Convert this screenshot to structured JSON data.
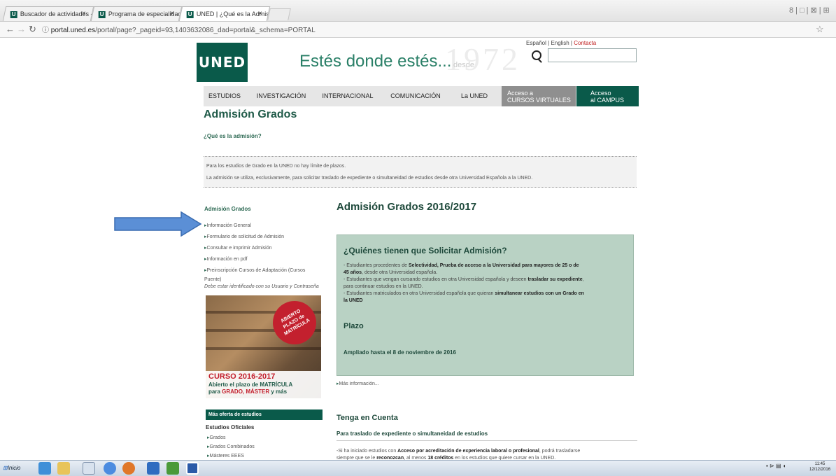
{
  "browser": {
    "tabs": [
      {
        "label": "Buscador de actividades - U"
      },
      {
        "label": "Programa de especialidad e"
      },
      {
        "label": "UNED | ¿Qué es la Admisión"
      }
    ],
    "url_host": "portal.uned.es",
    "url_path": "/portal/page?_pageid=93,1403632086_dad=portal&_schema=PORTAL",
    "window_controls": "8|□|⊠|⊞"
  },
  "header": {
    "lang_es": "Español",
    "lang_en": "English",
    "contact": "Contacta",
    "logo": "UNED",
    "tagline": "Estés donde estés...",
    "tagline_sub": "desde",
    "watermark": "1972"
  },
  "menu": {
    "items": [
      "ESTUDIOS",
      "INVESTIGACIÓN",
      "INTERNACIONAL",
      "COMUNICACIÓN",
      "La UNED"
    ],
    "virtual_line1": "Acceso a",
    "virtual_line2": "CURSOS VIRTUALES",
    "campus_line1": "Acceso",
    "campus_line2": "al CAMPUS"
  },
  "page": {
    "title": "Admisión Grados",
    "subtitle": "¿Qué es la admisión?",
    "info1": "Para los estudios de Grado en la UNED no hay límite de plazos.",
    "info2": "La admisión se utiliza, exclusivamente, para solicitar traslado de expediente o simultaneidad de estudios desde otra Universidad Española a la UNED."
  },
  "sidebar": {
    "heading": "Admisión Grados",
    "links": [
      "Información General",
      "Formulario de solicitud de Admisión",
      "Consultar e imprimir Admisión",
      "Información en pdf",
      "Preinscripción Cursos de Adaptación (Cursos"
    ],
    "link_cont": "Puente)",
    "note": "Debe estar identificado con su Usuario y Contraseña",
    "banner": {
      "badge_1": "ABIERTO",
      "badge_2": "PLAZO de",
      "badge_3": "MATRÍCULA",
      "line1": "CURSO 2016-2017",
      "line2": "Abierto el plazo de MATRÍCULA",
      "line3_a": "para",
      "line3_b": "GRADO, MÁSTER",
      "line3_c": "y más"
    },
    "more_box": "Más oferta de estudios",
    "more_heading": "Estudios Oficiales",
    "more_links": [
      "Grados",
      "Grados Combinados",
      "Másteres EEES"
    ]
  },
  "main": {
    "heading": "Admisión Grados 2016/2017",
    "box_question": "¿Quiénes tienen que Solicitar Admisión?",
    "box_l1_a": "- Estudiantes procedentes de ",
    "box_l1_b": "Selectividad, Prueba de acceso a la Universidad para mayores de 25 o de",
    "box_l2_a": "45 años",
    "box_l2_b": ", desde otra Universidad española.",
    "box_l3_a": "- Estudiantes que vengan cursando estudios en otra Universidad española y deseen ",
    "box_l3_b": "trasladar su expediente",
    "box_l3_c": ",",
    "box_l4": "para continuar estudios en la UNED.",
    "box_l5_a": "- Estudiantes matriculados en otra Universidad española que quieran ",
    "box_l5_b": "simultanear estudios con un Grado en",
    "box_l6": "la UNED",
    "plazo": "Plazo",
    "ampliado": "Ampliado hasta el 8 de noviembre de 2016",
    "more_info": "Más información...",
    "tenga": "Tenga en Cuenta",
    "traslado": "Para traslado de expediente o simultaneidad de estudios",
    "bt1_a": "-Si ha iniciado estudios con ",
    "bt1_b": "Acceso por acreditación de experiencia laboral o profesional",
    "bt1_c": ", podrá trasladarse",
    "bt2_a": "siempre que se le ",
    "bt2_b": "reconozcan",
    "bt2_c": ", al menos ",
    "bt2_d": "18 créditos",
    "bt2_e": " en los estudios que quiere cursar en la UNED."
  },
  "taskbar": {
    "start": "Inicio",
    "time": "11:45",
    "date": "12/12/2016"
  }
}
